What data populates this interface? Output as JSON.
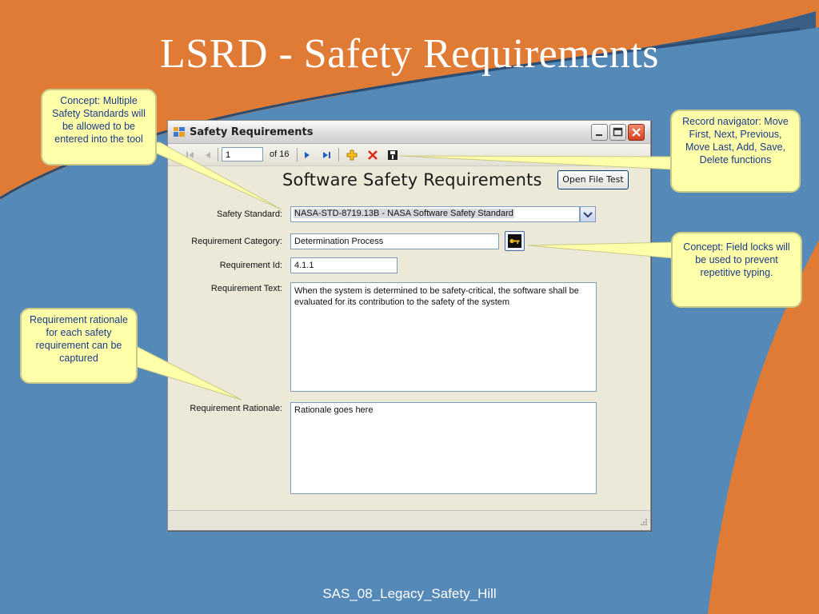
{
  "slide": {
    "title": "LSRD - Safety Requirements",
    "footer": "SAS_08_Legacy_Safety_Hill"
  },
  "window": {
    "title": "Safety Requirements",
    "navigator": {
      "position": "1",
      "count_label": "of 16"
    },
    "heading": "Software Safety Requirements",
    "open_file_button": "Open File Test",
    "fields": {
      "safety_standard": {
        "label": "Safety Standard:",
        "value": "NASA-STD-8719.13B - NASA Software Safety Standard"
      },
      "requirement_category": {
        "label": "Requirement Category:",
        "value": "Determination Process"
      },
      "requirement_id": {
        "label": "Requirement Id:",
        "value": "4.1.1"
      },
      "requirement_text": {
        "label": "Requirement Text:",
        "value": "When the system is determined to be safety-critical, the software shall be evaluated for its contribution to the safety of the system"
      },
      "requirement_rationale": {
        "label": "Requirement Rationale:",
        "value": "Rationale goes here"
      }
    }
  },
  "callouts": {
    "standards": "Concept: Multiple Safety Standards will be allowed to be entered into the tool",
    "navigator": "Record navigator: Move First, Next, Previous, Move Last, Add, Save, Delete functions",
    "field_locks": "Concept: Field locks will be used to prevent repetitive typing.",
    "rationale": "Requirement rationale for each safety requirement can be captured"
  },
  "colors": {
    "slide_orange": "#e07b35",
    "slide_blue": "#5589b8",
    "callout_fill": "#ffffaa",
    "callout_text": "#1a3a8a"
  }
}
